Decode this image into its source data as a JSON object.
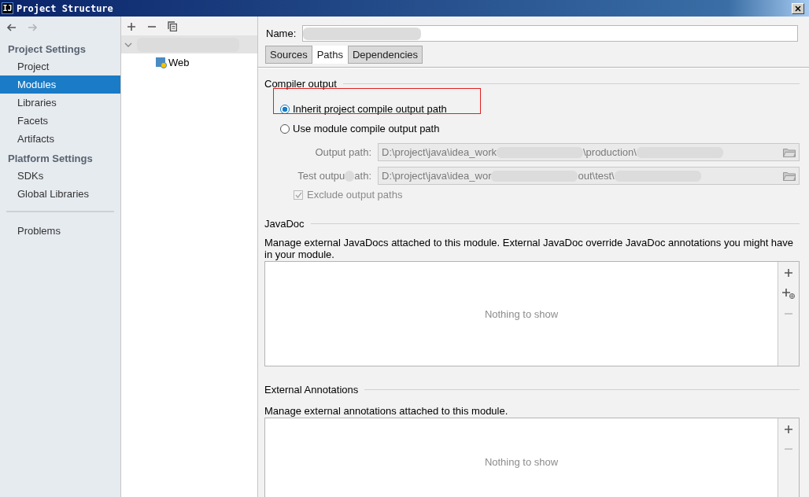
{
  "window": {
    "title": "Project Structure",
    "logo": "IJ"
  },
  "nav": [
    {
      "kind": "back",
      "disabled": false
    },
    {
      "kind": "forward",
      "disabled": true
    }
  ],
  "sidebar": {
    "sections": [
      {
        "title": "Project Settings",
        "items": [
          {
            "label": "Project",
            "selected": false
          },
          {
            "label": "Modules",
            "selected": true
          },
          {
            "label": "Libraries",
            "selected": false
          },
          {
            "label": "Facets",
            "selected": false
          },
          {
            "label": "Artifacts",
            "selected": false
          }
        ]
      },
      {
        "title": "Platform Settings",
        "items": [
          {
            "label": "SDKs",
            "selected": false
          },
          {
            "label": "Global Libraries",
            "selected": false
          }
        ]
      },
      {
        "separator": true,
        "items": [
          {
            "label": "Problems",
            "selected": false
          }
        ]
      }
    ]
  },
  "tree": {
    "tools": [
      {
        "kind": "add"
      },
      {
        "kind": "remove"
      },
      {
        "kind": "copy"
      }
    ],
    "nodes": [
      {
        "redacted": true,
        "expanded": true,
        "selected": true,
        "children": [
          {
            "label": "Web",
            "selected": false
          }
        ]
      }
    ]
  },
  "name_field": {
    "label": "Name:",
    "redacted": true
  },
  "tabs": [
    {
      "label": "Sources",
      "selected": false
    },
    {
      "label": "Paths",
      "selected": true
    },
    {
      "label": "Dependencies",
      "selected": false
    }
  ],
  "compiler_output": {
    "title": "Compiler output",
    "options": [
      {
        "label": "Inherit project compile output path",
        "selected": true,
        "highlighted": true
      },
      {
        "label": "Use module compile output path",
        "selected": false,
        "highlighted": false
      }
    ],
    "paths": [
      {
        "label": [
          {
            "kind": "text",
            "text": "Output path:"
          }
        ],
        "value": [
          {
            "kind": "text",
            "text": "D:\\project\\java\\idea_work"
          },
          {
            "kind": "blur"
          },
          {
            "kind": "text",
            "text": "\\production\\"
          },
          {
            "kind": "blur"
          }
        ],
        "disabled": true
      },
      {
        "label": [
          {
            "kind": "text",
            "text": "Test outpu"
          },
          {
            "kind": "blur"
          },
          {
            "kind": "text",
            "text": "ath:"
          }
        ],
        "value": [
          {
            "kind": "text",
            "text": "D:\\project\\java\\idea_wor"
          },
          {
            "kind": "blur"
          },
          {
            "kind": "text",
            "text": "out\\test\\"
          },
          {
            "kind": "blur"
          }
        ],
        "disabled": true
      }
    ],
    "exclude": {
      "label": "Exclude output paths",
      "checked": true,
      "disabled": true
    }
  },
  "panels": [
    {
      "title": "JavaDoc",
      "description": "Manage external JavaDocs attached to this module. External JavaDoc override JavaDoc annotations you might have in your module.",
      "empty_text": "Nothing to show",
      "tools": [
        {
          "kind": "add",
          "disabled": false
        },
        {
          "kind": "add-link",
          "disabled": false
        },
        {
          "kind": "remove",
          "disabled": true
        }
      ]
    },
    {
      "title": "External Annotations",
      "description": "Manage external annotations attached to this module.",
      "empty_text": "Nothing to show",
      "tools": [
        {
          "kind": "add",
          "disabled": false
        },
        {
          "kind": "remove",
          "disabled": true
        }
      ]
    }
  ]
}
